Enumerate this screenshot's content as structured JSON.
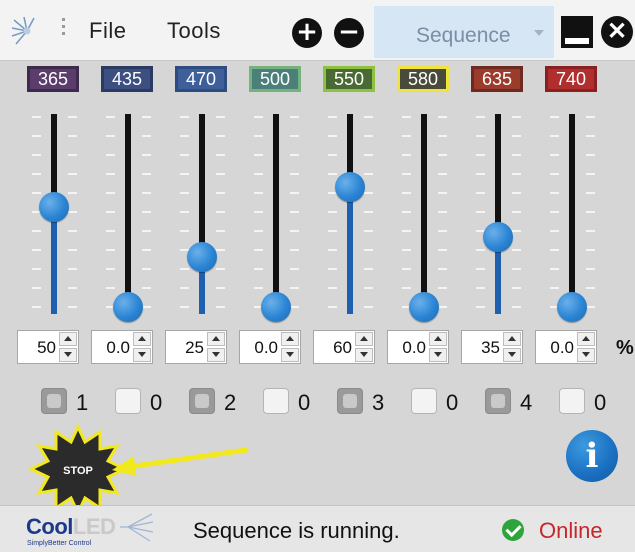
{
  "menu": {
    "file_label": "File",
    "tools_label": "Tools",
    "sequence_value": "Sequence"
  },
  "channels": [
    {
      "wavelength": "365",
      "color": "#5a3d6b",
      "border": "#3e2a4c",
      "value": "50",
      "level": 0.5,
      "checked": true,
      "check_label": "1"
    },
    {
      "wavelength": "435",
      "color": "#3d4f80",
      "border": "#2b3a62",
      "value": "0.0",
      "level": 0.0,
      "checked": false,
      "check_label": "0"
    },
    {
      "wavelength": "470",
      "color": "#3e5f9a",
      "border": "#2e4c80",
      "value": "25",
      "level": 0.25,
      "checked": true,
      "check_label": "2"
    },
    {
      "wavelength": "500",
      "color": "#4b7f7a",
      "border": "#76b27e",
      "value": "0.0",
      "level": 0.0,
      "checked": false,
      "check_label": "0"
    },
    {
      "wavelength": "550",
      "color": "#4a6a33",
      "border": "#8ec23e",
      "value": "60",
      "level": 0.6,
      "checked": true,
      "check_label": "3"
    },
    {
      "wavelength": "580",
      "color": "#4a4a3a",
      "border": "#f0e33a",
      "value": "0.0",
      "level": 0.0,
      "checked": false,
      "check_label": "0"
    },
    {
      "wavelength": "635",
      "color": "#9b3b2c",
      "border": "#6e2a20",
      "value": "35",
      "level": 0.35,
      "checked": true,
      "check_label": "4"
    },
    {
      "wavelength": "740",
      "color": "#b02e2e",
      "border": "#8a2020",
      "value": "0.0",
      "level": 0.0,
      "checked": false,
      "check_label": "0"
    }
  ],
  "unit_label": "%",
  "stop_label": "STOP",
  "info_label": "i",
  "status": {
    "brand_cool": "Cool",
    "brand_led": "LED",
    "brand_tagline": "SimplyBetter Control",
    "message": "Sequence is running.",
    "online_label": "Online"
  },
  "colors": {
    "slider_fill": "#1f5fb0",
    "thumb": "#2a84d4",
    "annotation_arrow": "#f2e81e",
    "online_green": "#2ea53c",
    "online_text": "#c6272a"
  }
}
